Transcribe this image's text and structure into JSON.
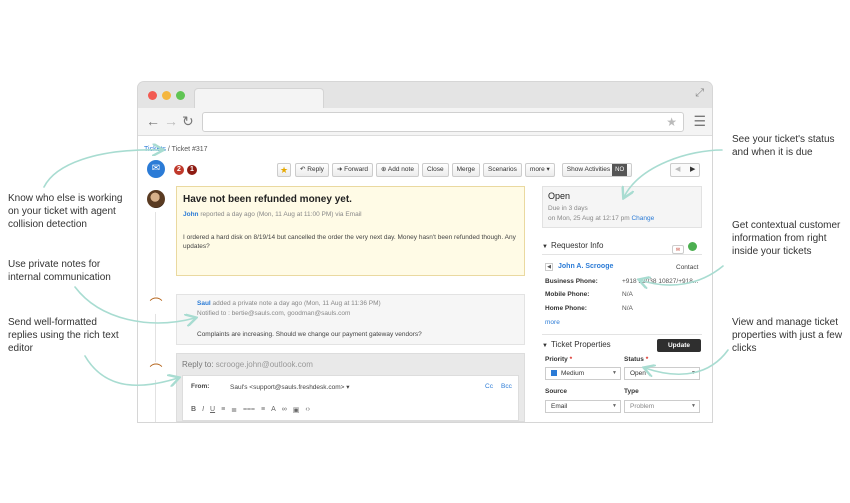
{
  "browser": {
    "nav": {
      "back": "←",
      "forward": "→",
      "reload": "↻"
    }
  },
  "breadcrumb": {
    "tickets": "Tickets",
    "separator": " / ",
    "current": "Ticket #317"
  },
  "badges": {
    "first": "2",
    "second": "1"
  },
  "toolbar": {
    "reply": "Reply",
    "forward": "Forward",
    "add_note": "Add note",
    "close": "Close",
    "merge": "Merge",
    "scenarios": "Scenarios",
    "more": "more",
    "show_activities": "Show Activities",
    "no": "NO"
  },
  "message": {
    "title": "Have not been refunded money yet.",
    "author": "John",
    "meta": " reported a day ago (Mon, 11 Aug at 11:00 PM) via Email",
    "body": "I ordered a hard disk on 8/19/14 but cancelled the order the very next day. Money hasn't been refunded though. Any updates?"
  },
  "note": {
    "author": "Saul",
    "meta": " added a private note a day ago (Mon, 11 Aug at 11:36 PM)",
    "notified": "Notified to : bertie@sauls.com, goodman@sauls.com",
    "body": "Complaints are increasing. Should we change our payment gateway vendors?"
  },
  "reply": {
    "label": "Reply to: ",
    "address": "scrooge.john@outlook.com",
    "from_label": "From:",
    "from_value": "Saul's <support@sauls.freshdesk.com>",
    "cc": "Cc",
    "bcc": "Bcc",
    "editor_tools": [
      "B",
      "I",
      "U",
      "≡",
      "≣",
      "⩶",
      "≡",
      "A",
      "∞",
      "▣",
      "‹›"
    ]
  },
  "status": {
    "name": "Open",
    "due": "Due in 3 days",
    "date": "on Mon, 25 Aug at 12:17 pm ",
    "change": "Change"
  },
  "requestor": {
    "heading": "Requestor Info",
    "name": "John A. Scrooge",
    "tag": "Contact",
    "business_label": "Business Phone:",
    "business_value": "+918 22038 10827/+918...",
    "mobile_label": "Mobile Phone:",
    "mobile_value": "N/A",
    "home_label": "Home Phone:",
    "home_value": "N/A",
    "more": "more"
  },
  "properties": {
    "heading": "Ticket Properties",
    "update": "Update",
    "priority_label": "Priority",
    "priority_value": "Medium",
    "status_label": "Status",
    "status_value": "Open",
    "source_label": "Source",
    "source_value": "Email",
    "type_label": "Type",
    "type_value": "Problem"
  },
  "annotations": {
    "status_line1": "See your ticket's status",
    "status_line2": "and when it is due",
    "collision_line1": "Know who else is working",
    "collision_line2": "on your ticket with agent",
    "collision_line3": "collision detection",
    "contextual_line1": "Get contextual customer",
    "contextual_line2": "information from right",
    "contextual_line3": "inside your tickets",
    "notes_line1": "Use private notes for",
    "notes_line2": "internal communication",
    "manage_line1": "View and manage ticket",
    "manage_line2": "properties with just a few",
    "manage_line3": "clicks",
    "replies_line1": "Send well-formatted",
    "replies_line2": "replies using the rich text",
    "replies_line3": "editor"
  },
  "colors": {
    "accent": "#2b7bd6",
    "arrow": "#a8dcd1",
    "message_bg": "#fffbe6",
    "update_btn": "#2f2f2f"
  }
}
